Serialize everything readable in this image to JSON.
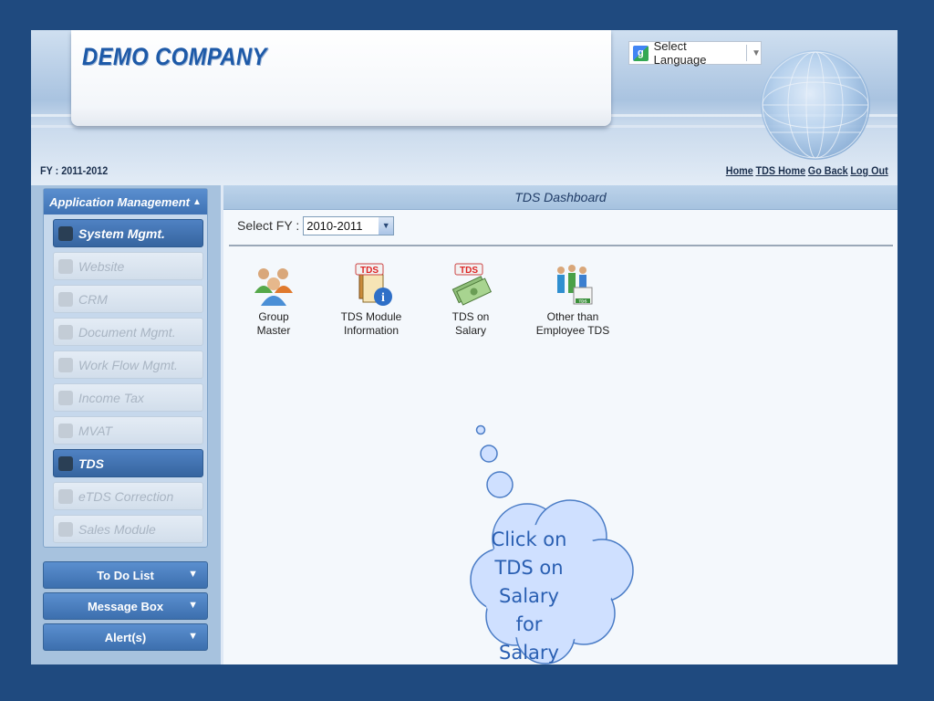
{
  "header": {
    "company_name": "DEMO COMPANY",
    "language_select": "Select Language",
    "fy_label": "FY : 2011-2012",
    "links": [
      "Home",
      "TDS Home",
      "Go Back",
      "Log Out"
    ]
  },
  "sidebar": {
    "section_title": "Application Management",
    "items": [
      {
        "label": "System Mgmt.",
        "state": "active"
      },
      {
        "label": "Website",
        "state": "inactive"
      },
      {
        "label": "CRM",
        "state": "inactive"
      },
      {
        "label": "Document Mgmt.",
        "state": "inactive"
      },
      {
        "label": "Work Flow Mgmt.",
        "state": "inactive"
      },
      {
        "label": "Income Tax",
        "state": "inactive"
      },
      {
        "label": "MVAT",
        "state": "inactive"
      },
      {
        "label": "TDS",
        "state": "active"
      },
      {
        "label": "eTDS Correction",
        "state": "inactive"
      },
      {
        "label": "Sales Module",
        "state": "inactive"
      }
    ],
    "bottom_boxes": [
      "To Do List",
      "Message Box",
      "Alert(s)"
    ]
  },
  "main": {
    "title": "TDS Dashboard",
    "fy_select_label": "Select FY :",
    "fy_select_value": "2010-2011",
    "tiles": [
      {
        "line1": "Group",
        "line2": "Master",
        "icon": "group-users-icon"
      },
      {
        "line1": "TDS Module",
        "line2": "Information",
        "icon": "tds-info-icon"
      },
      {
        "line1": "TDS on",
        "line2": "Salary",
        "icon": "tds-salary-icon"
      },
      {
        "line1": "Other than",
        "line2": "Employee TDS",
        "icon": "tds-other-icon"
      }
    ]
  },
  "callout": {
    "lines": [
      "Click on",
      "TDS on",
      "Salary for",
      "Salary"
    ]
  },
  "colors": {
    "background": "#1f4a7f",
    "accent": "#3f72b4",
    "company_text": "#1e5aa8",
    "callout_fill": "#cfe0ff",
    "callout_text": "#2a5fb2"
  }
}
